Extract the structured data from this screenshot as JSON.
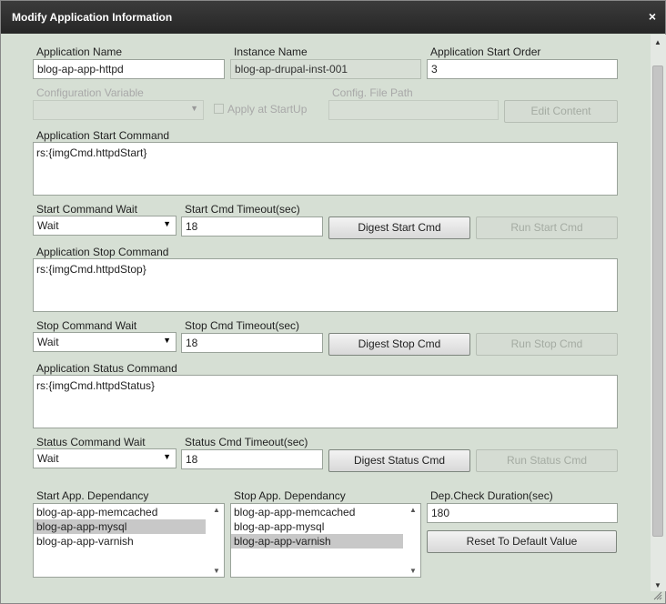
{
  "window": {
    "title": "Modify Application Information",
    "close": "×"
  },
  "app_name": {
    "label": "Application Name",
    "value": "blog-ap-app-httpd"
  },
  "instance_name": {
    "label": "Instance Name",
    "value": "blog-ap-drupal-inst-001"
  },
  "start_order": {
    "label": "Application Start Order",
    "value": "3"
  },
  "config_var": {
    "label": "Configuration Variable",
    "value": ""
  },
  "apply_startup": {
    "label": "Apply at StartUp",
    "checked": false
  },
  "config_path": {
    "label": "Config. File Path",
    "value": ""
  },
  "edit_content": {
    "label": "Edit Content"
  },
  "start_cmd": {
    "label": "Application Start Command",
    "value": "rs:{imgCmd.httpdStart}"
  },
  "start_wait": {
    "label": "Start Command Wait",
    "value": "Wait"
  },
  "start_timeout": {
    "label": "Start Cmd Timeout(sec)",
    "value": "18"
  },
  "digest_start": {
    "label": "Digest Start Cmd"
  },
  "run_start": {
    "label": "Run Start Cmd"
  },
  "stop_cmd": {
    "label": "Application Stop Command",
    "value": "rs:{imgCmd.httpdStop}"
  },
  "stop_wait": {
    "label": "Stop Command Wait",
    "value": "Wait"
  },
  "stop_timeout": {
    "label": "Stop Cmd Timeout(sec)",
    "value": "18"
  },
  "digest_stop": {
    "label": "Digest Stop Cmd"
  },
  "run_stop": {
    "label": "Run Stop Cmd"
  },
  "status_cmd": {
    "label": "Application Status Command",
    "value": "rs:{imgCmd.httpdStatus}"
  },
  "status_wait": {
    "label": "Status Command Wait",
    "value": "Wait"
  },
  "status_timeout": {
    "label": "Status Cmd Timeout(sec)",
    "value": "18"
  },
  "digest_status": {
    "label": "Digest Status Cmd"
  },
  "run_status": {
    "label": "Run Status Cmd"
  },
  "start_dep": {
    "label": "Start App. Dependancy",
    "items": [
      {
        "label": "blog-ap-app-memcached",
        "selected": false
      },
      {
        "label": "blog-ap-app-mysql",
        "selected": true
      },
      {
        "label": "blog-ap-app-varnish",
        "selected": false
      }
    ]
  },
  "stop_dep": {
    "label": "Stop App. Dependancy",
    "items": [
      {
        "label": "blog-ap-app-memcached",
        "selected": false
      },
      {
        "label": "blog-ap-app-mysql",
        "selected": false
      },
      {
        "label": "blog-ap-app-varnish",
        "selected": true
      }
    ]
  },
  "dep_check": {
    "label": "Dep.Check Duration(sec)",
    "value": "180"
  },
  "reset_default": {
    "label": "Reset To Default Value"
  },
  "icons": {
    "dropdown": "▼",
    "scroll_up": "▲",
    "scroll_down": "▼",
    "close": "close-icon",
    "resize": "resize-grip-icon"
  }
}
